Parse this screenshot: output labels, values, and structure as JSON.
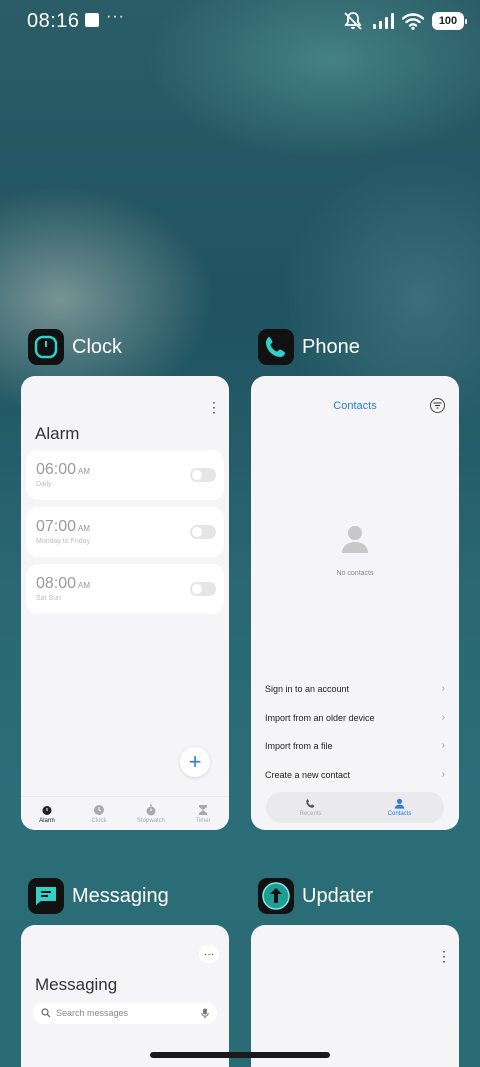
{
  "status_bar": {
    "time": "08:16",
    "dots": "···",
    "battery": "100"
  },
  "apps": {
    "clock": {
      "name": "Clock",
      "screen_title": "Alarm",
      "alarms": [
        {
          "time": "06:00",
          "ampm": "AM",
          "repeat": "Daily"
        },
        {
          "time": "07:00",
          "ampm": "AM",
          "repeat": "Monday to Friday"
        },
        {
          "time": "08:00",
          "ampm": "AM",
          "repeat": "Sat Sun"
        }
      ],
      "add_label": "+",
      "tabs": [
        "Alarm",
        "Clock",
        "Stopwatch",
        "Timer"
      ]
    },
    "phone": {
      "name": "Phone",
      "screen_title": "Contacts",
      "empty_text": "No contacts",
      "actions": [
        "Sign in to an account",
        "Import from an older device",
        "Import from a file",
        "Create a new contact"
      ],
      "tabs": [
        "Recents",
        "Contacts"
      ]
    },
    "messaging": {
      "name": "Messaging",
      "screen_title": "Messaging",
      "search_placeholder": "Search messages"
    },
    "updater": {
      "name": "Updater"
    }
  },
  "colors": {
    "accent": "#2a7de1",
    "icon_teal": "#2fd1c9"
  }
}
